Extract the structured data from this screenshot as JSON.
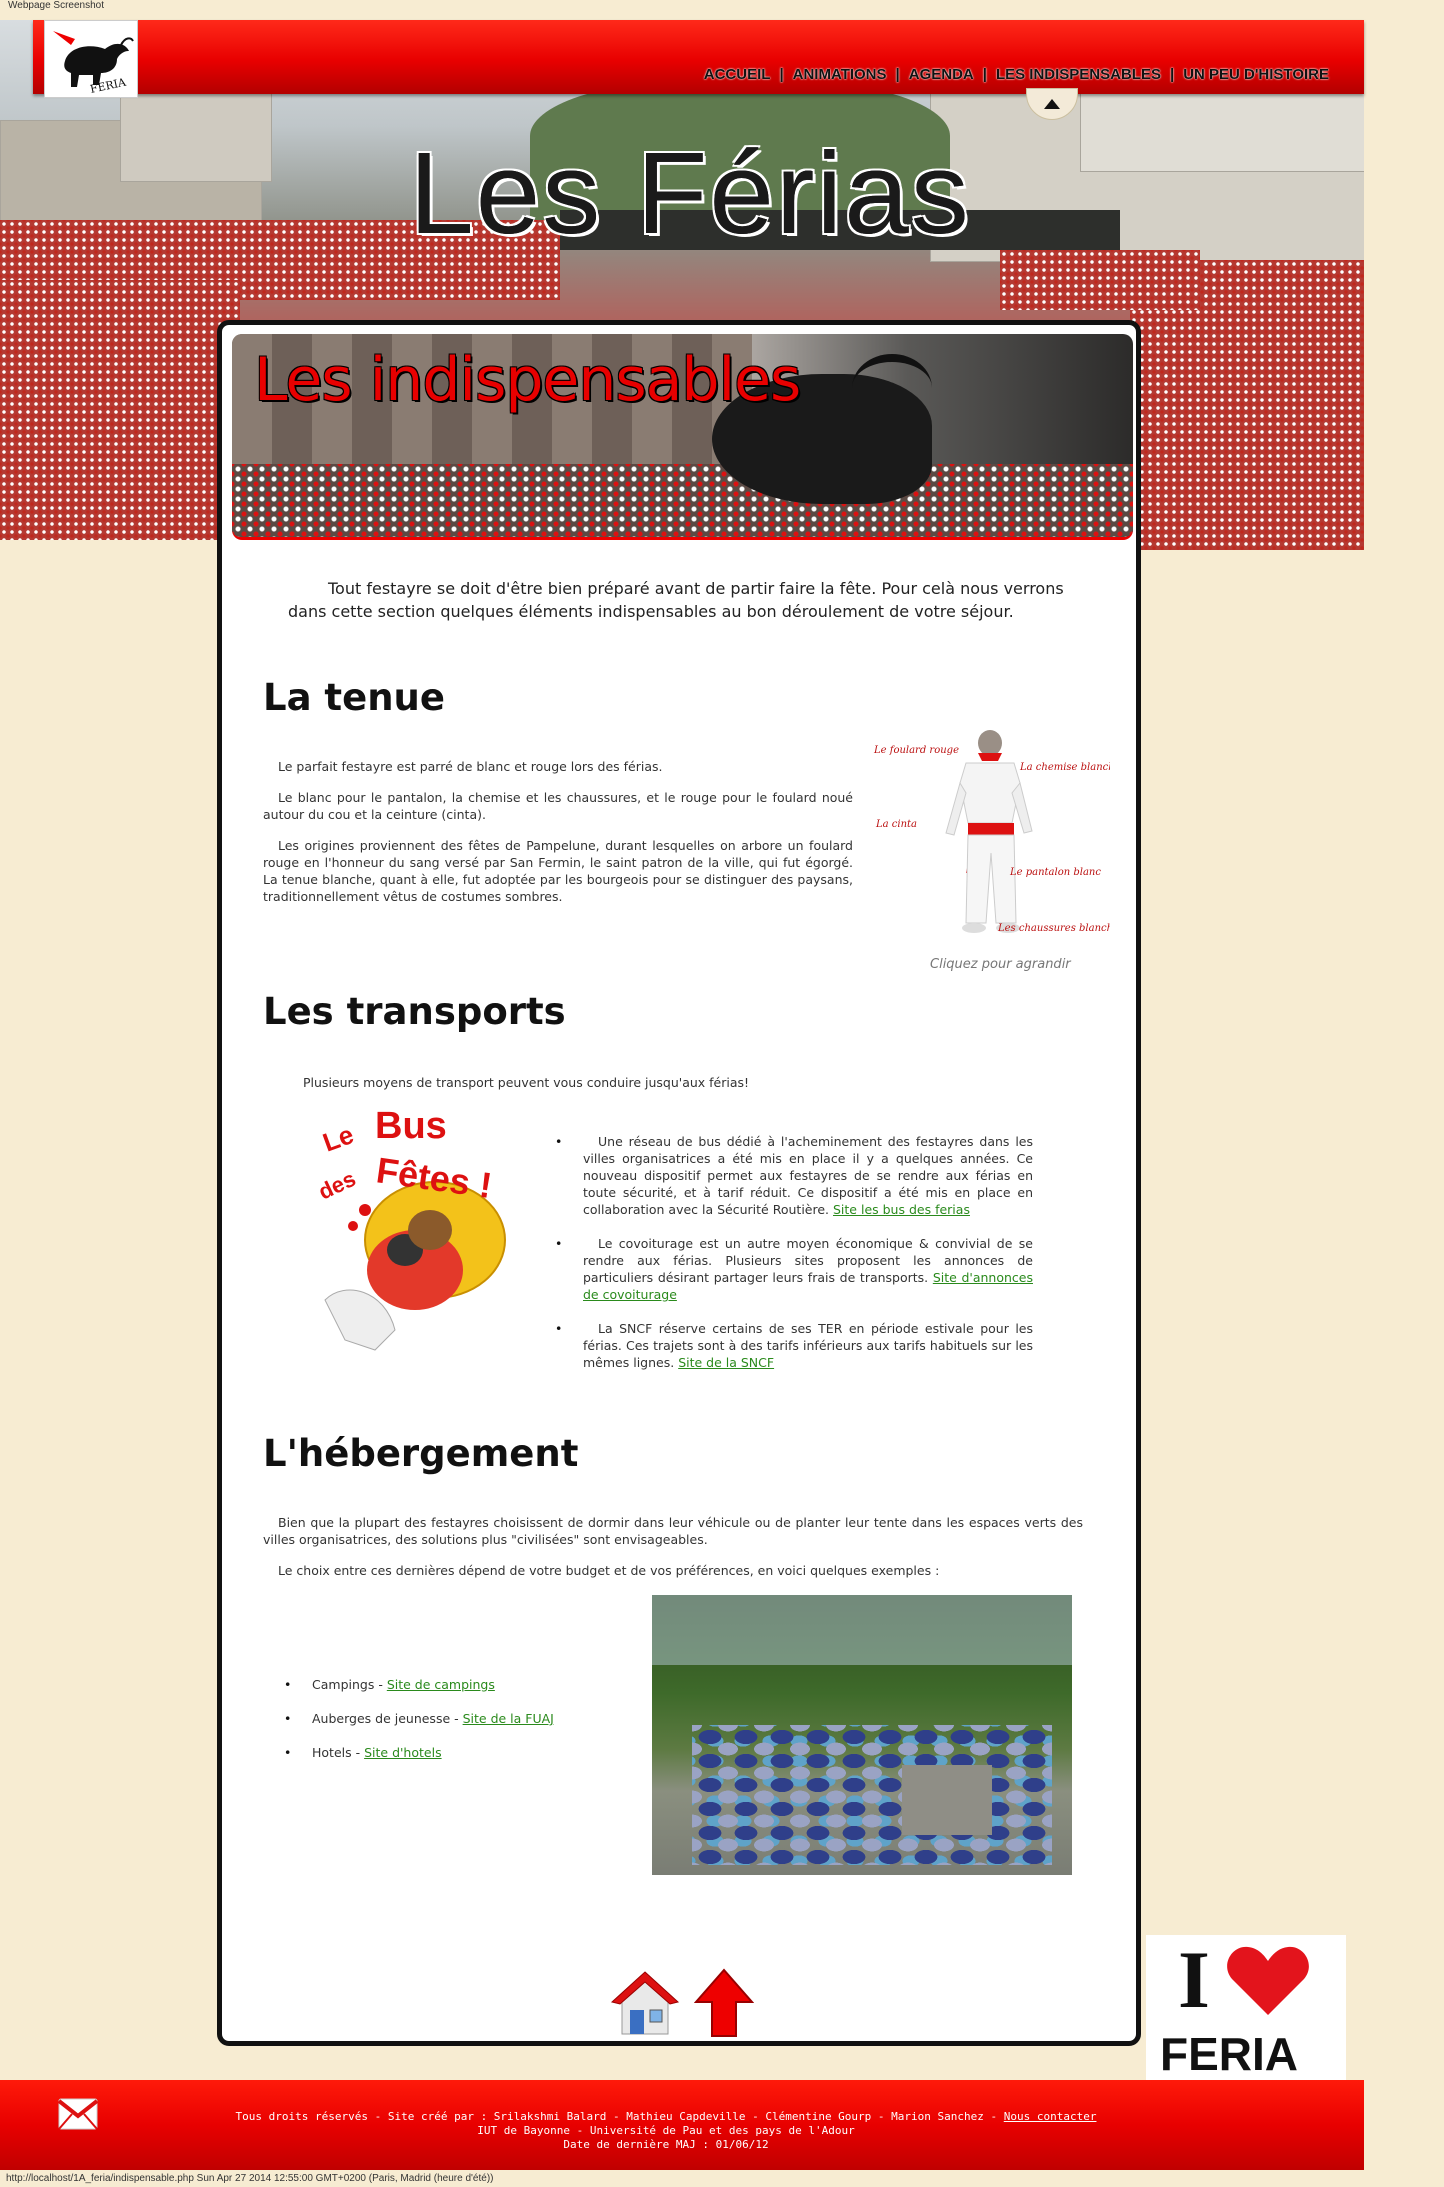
{
  "page": {
    "screenshot_label": "Webpage Screenshot",
    "status_url": "http://localhost/1A_feria/indispensable.php Sun Apr 27 2014 12:55:00 GMT+0200 (Paris, Madrid (heure d'été))"
  },
  "header": {
    "logo_text": "FERIA",
    "site_title": "Les Férias",
    "nav": [
      {
        "label": "ACCUEIL"
      },
      {
        "label": "ANIMATIONS"
      },
      {
        "label": "AGENDA"
      },
      {
        "label": "LES INDISPENSABLES"
      },
      {
        "label": "UN PEU D'HISTOIRE"
      }
    ]
  },
  "banner": {
    "title": "Les indispensables"
  },
  "intro": "Tout festayre se doit d'être bien préparé avant de partir faire la fête. Pour celà nous verrons dans cette section quelques éléments indispensables au bon déroulement de votre séjour.",
  "tenue": {
    "heading": "La tenue",
    "p1": "Le parfait festayre est parré de blanc et rouge lors des férias.",
    "p2": "Le blanc pour le pantalon, la chemise et les chaussures, et le rouge pour le foulard noué autour du cou et la ceinture (cinta).",
    "p3": "Les origines proviennent des fêtes de Pampelune, durant lesquelles on arbore un foulard rouge en l'honneur du sang versé par San Fermin, le saint patron de la ville, qui fut égorgé. La tenue blanche, quant à elle, fut adoptée par les bourgeois pour se distinguer des paysans, traditionnellement vêtus de costumes sombres.",
    "figure_labels": {
      "foulard": "Le foulard rouge",
      "chemise": "La chemise blanche",
      "cinta": "La cinta",
      "pantalon": "Le pantalon blanc",
      "chaussures": "Les chaussures blanches"
    },
    "caption": "Cliquez pour agrandir"
  },
  "transports": {
    "heading": "Les transports",
    "intro": "Plusieurs moyens de transport peuvent vous conduire jusqu'aux férias!",
    "bus_logo": {
      "line1": "Le",
      "line2": "Bus",
      "line3": "des",
      "line4": "Fêtes !"
    },
    "items": [
      {
        "text": "Une réseau de bus dédié à l'acheminement des festayres dans les villes organisatrices a été mis en place il y a quelques années. Ce nouveau dispositif permet aux festayres de se rendre aux férias en toute sécurité, et à tarif réduit. Ce dispositif a été mis en place en collaboration avec la Sécurité Routière.",
        "link": "Site les bus des ferias"
      },
      {
        "text": "Le covoiturage est un autre moyen économique & convivial de se rendre aux férias. Plusieurs sites proposent les annonces de particuliers désirant partager leurs frais de transports.",
        "link": "Site d'annonces de covoiturage"
      },
      {
        "text": "La SNCF réserve certains de ses TER en période estivale pour les férias. Ces trajets sont à des tarifs inférieurs aux tarifs habituels sur les mêmes lignes.",
        "link": "Site de la SNCF"
      }
    ]
  },
  "hebergement": {
    "heading": "L'hébergement",
    "p1": "Bien que la plupart des festayres choisissent de dormir dans leur véhicule ou de planter leur tente dans les espaces verts des villes organisatrices, des solutions plus \"civilisées\" sont envisageables.",
    "p2": "Le choix entre ces dernières dépend de votre budget et de vos préférences, en voici quelques exemples :",
    "items": [
      {
        "label": "Campings - ",
        "link": "Site de campings"
      },
      {
        "label": "Auberges de jeunesse - ",
        "link": "Site de la FUAJ"
      },
      {
        "label": "Hotels - ",
        "link": "Site d'hotels"
      }
    ]
  },
  "side_badge": {
    "i_text": "I",
    "feria_text": "FERIA"
  },
  "footer": {
    "line1_prefix": "Tous droits réservés - Site créé par : Srilakshmi Balard - Mathieu Capdeville - Clémentine Gourp - Marion Sanchez - ",
    "contact_link": "Nous contacter",
    "line2": "IUT de Bayonne - Université de Pau et des pays de l'Adour",
    "line3": "Date de dernière MAJ : 01/06/12"
  },
  "colors": {
    "brand_red": "#e80000",
    "link_green": "#2a8a1c",
    "background": "#f7ecd2"
  }
}
